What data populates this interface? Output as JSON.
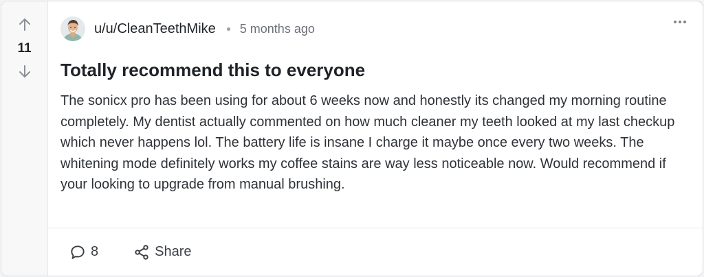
{
  "post": {
    "score": "11",
    "username": "u/u/CleanTeethMike",
    "timestamp": "5 months ago",
    "title": "Totally recommend this to everyone",
    "body": "The sonicx pro has been using for about 6 weeks now and honestly its changed my morning routine completely. My dentist actually commented on how much cleaner my teeth looked at my last checkup which never happens lol. The battery life is insane I charge it maybe once every two weeks. The whitening mode definitely works my coffee stains are way less noticeable now. Would recommend if your looking to upgrade from manual brushing.",
    "comment_count": "8",
    "share_label": "Share"
  },
  "icons": {
    "upvote": "arrow-up-icon",
    "downvote": "arrow-down-icon",
    "more": "more-horizontal-icon",
    "comment": "comment-icon",
    "share": "share-icon"
  }
}
